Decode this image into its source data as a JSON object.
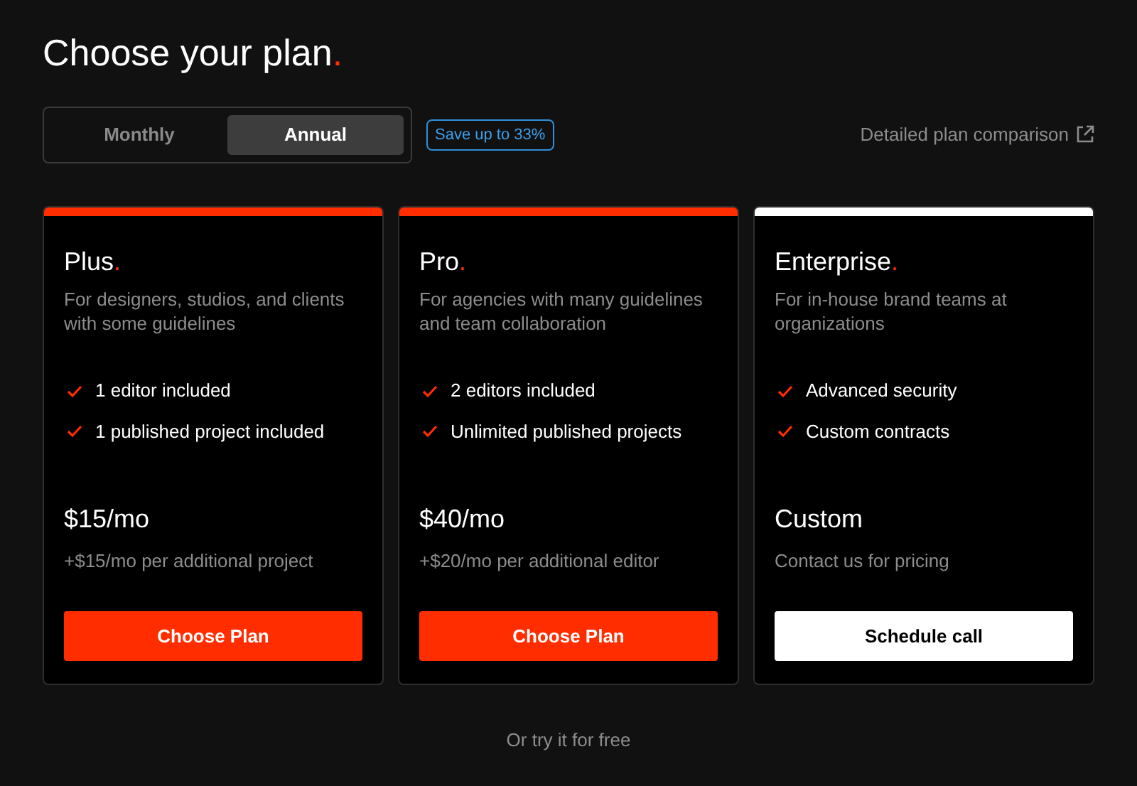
{
  "heading": {
    "text": "Choose your plan",
    "mark": "."
  },
  "billing_toggle": [
    {
      "label": "Monthly",
      "selected": false
    },
    {
      "label": "Annual",
      "selected": true
    }
  ],
  "savings_badge": "Save up to 33%",
  "comparison_link": "Detailed plan comparison",
  "plans": [
    {
      "name": "Plus",
      "mark": ".",
      "color": "#ff2d00",
      "description": "For designers, studios, and clients with some guidelines",
      "features": [
        "1 editor included",
        "1 published project included"
      ],
      "price": "$15/mo",
      "price_note": "+$15/mo per additional project",
      "button": {
        "label": "Choose Plan",
        "kind": "primary"
      }
    },
    {
      "name": "Pro",
      "mark": ".",
      "color": "#ff2d00",
      "description": "For agencies with many guidelines and team collaboration",
      "features": [
        "2 editors included",
        "Unlimited published projects"
      ],
      "price": "$40/mo",
      "price_note": "+$20/mo per additional editor",
      "button": {
        "label": "Choose Plan",
        "kind": "primary"
      }
    },
    {
      "name": "Enterprise",
      "mark": ".",
      "color": "#ffffff",
      "description": "For in-house brand teams at organizations",
      "features": [
        "Advanced security",
        "Custom contracts"
      ],
      "price": "Custom",
      "price_note": "Contact us for pricing",
      "button": {
        "label": "Schedule call",
        "kind": "light"
      }
    }
  ],
  "footer_link": "Or try it for free"
}
